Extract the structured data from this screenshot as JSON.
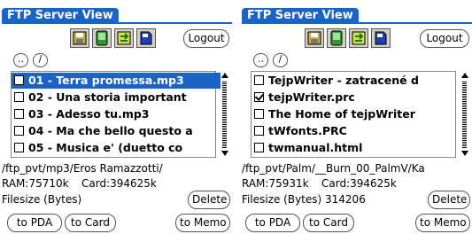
{
  "left": {
    "title": "FTP Server View",
    "logout_label": "Logout",
    "up_dir_label": "..",
    "root_dir_label": "/",
    "files": [
      {
        "name": "01 - Terra promessa.mp3",
        "checked": false,
        "selected": true
      },
      {
        "name": "02 - Una storia important",
        "checked": false,
        "selected": false
      },
      {
        "name": "03 - Adesso tu.mp3",
        "checked": false,
        "selected": false
      },
      {
        "name": "04 - Ma che bello questo a",
        "checked": false,
        "selected": false
      },
      {
        "name": "05 - Musica e' (duetto co",
        "checked": false,
        "selected": false
      }
    ],
    "path": "/ftp_pvt/mp3/Eros Ramazzotti/",
    "ram": "RAM:75710k",
    "card": "Card:394625k",
    "filesize": "Filesize (Bytes)",
    "delete_label": "Delete",
    "to_pda_label": "to PDA",
    "to_card_label": "to Card",
    "to_memo_label": "to Memo"
  },
  "right": {
    "title": "FTP Server View",
    "logout_label": "Logout",
    "up_dir_label": "..",
    "root_dir_label": "/",
    "files": [
      {
        "name": "TejpWriter - zatracené d",
        "checked": false,
        "selected": false
      },
      {
        "name": "tejpWriter.prc",
        "checked": true,
        "selected": false
      },
      {
        "name": "The Home of tejpWriter",
        "checked": false,
        "selected": false
      },
      {
        "name": "tWfonts.PRC",
        "checked": false,
        "selected": false
      },
      {
        "name": "twmanual.html",
        "checked": false,
        "selected": false
      }
    ],
    "path": "/ftp_pvt/Palm/__Burn_00_PalmV/Ka",
    "ram": "RAM:75931k",
    "card": "Card:394625k",
    "filesize": "Filesize (Bytes) 314206",
    "delete_label": "Delete",
    "to_pda_label": "to PDA",
    "to_card_label": "to Card",
    "to_memo_label": "to Memo"
  },
  "icons": [
    "save-disk-icon",
    "green-device-icon",
    "green-transfer-icon",
    "blue-card-icon"
  ],
  "colors": {
    "accent": "#1a64c8",
    "button_face": "#d4d0c8"
  }
}
